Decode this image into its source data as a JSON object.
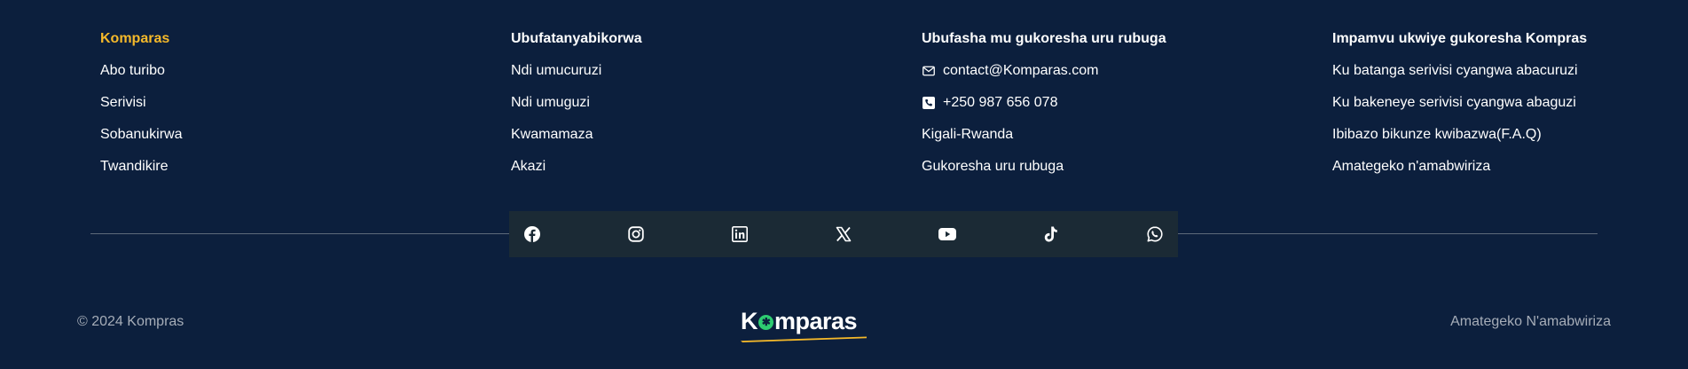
{
  "columns": [
    {
      "title": "Komparas",
      "accent": true,
      "items": [
        {
          "label": "Abo turibo"
        },
        {
          "label": "Serivisi"
        },
        {
          "label": "Sobanukirwa"
        },
        {
          "label": "Twandikire"
        }
      ]
    },
    {
      "title": "Ubufatanyabikorwa",
      "items": [
        {
          "label": "Ndi umucuruzi"
        },
        {
          "label": "Ndi umuguzi"
        },
        {
          "label": "Kwamamaza"
        },
        {
          "label": "Akazi"
        }
      ]
    },
    {
      "title": "Ubufasha mu gukoresha uru rubuga",
      "items": [
        {
          "label": "contact@Komparas.com",
          "icon": "mail-icon"
        },
        {
          "label": "+250 987 656 078",
          "icon": "phone-icon"
        },
        {
          "label": "Kigali-Rwanda"
        },
        {
          "label": "Gukoresha uru rubuga"
        }
      ]
    },
    {
      "title": "Impamvu ukwiye gukoresha Kompras",
      "items": [
        {
          "label": "Ku batanga serivisi cyangwa abacuruzi"
        },
        {
          "label": "Ku bakeneye serivisi cyangwa abaguzi"
        },
        {
          "label": "Ibibazo bikunze kwibazwa(F.A.Q)"
        },
        {
          "label": "Amategeko n'amabwiriza"
        }
      ]
    }
  ],
  "social": [
    "facebook-icon",
    "instagram-icon",
    "linkedin-icon",
    "x-icon",
    "youtube-icon",
    "tiktok-icon",
    "whatsapp-icon"
  ],
  "footer": {
    "copyright": "© 2024 Kompras",
    "logo_text_before": "K",
    "logo_text_after": "mparas",
    "terms": "Amategeko N'amabwiriza"
  },
  "colors": {
    "background": "#0c1f3d",
    "accent": "#f5b92a",
    "social_bar": "#1b2a35",
    "logo_dot": "#2ecc71",
    "muted_text": "#a6adb8"
  }
}
